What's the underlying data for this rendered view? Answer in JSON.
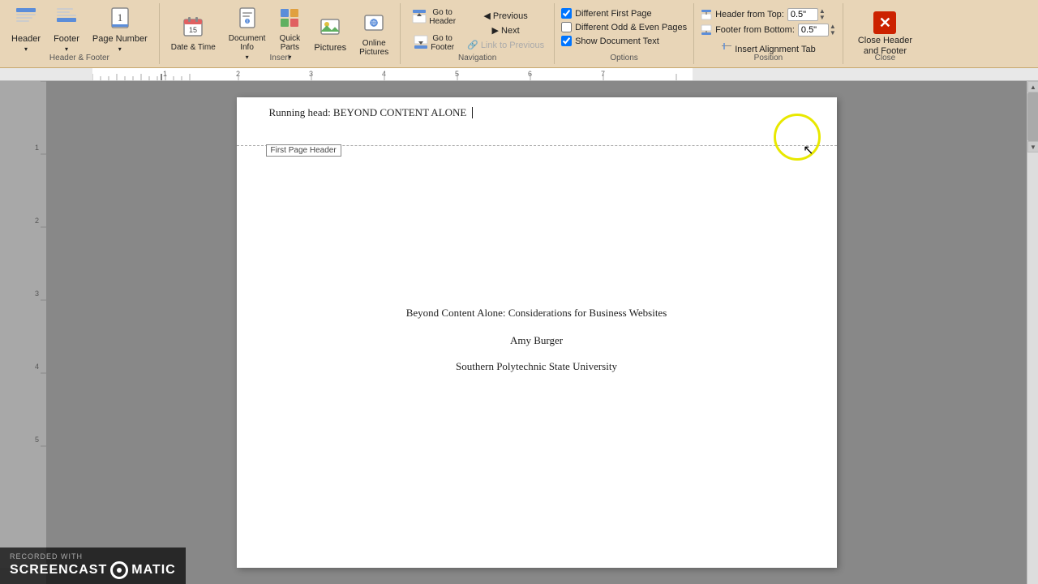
{
  "ribbon": {
    "groups": {
      "header_footer": {
        "label": "Header & Footer",
        "header_btn": {
          "label": "Header",
          "icon": "📄"
        },
        "footer_btn": {
          "label": "Footer",
          "icon": "📄"
        },
        "page_number_btn": {
          "label": "Page Number",
          "icon": "🔢"
        }
      },
      "insert": {
        "label": "Insert",
        "date_time": {
          "label": "Date & Time",
          "icon": "📅"
        },
        "document_info": {
          "label": "Document Info",
          "icon": "ℹ"
        },
        "quick_parts": {
          "label": "Quick Parts",
          "icon": "⚡"
        },
        "pictures": {
          "label": "Pictures",
          "icon": "🖼"
        },
        "online_pictures": {
          "label": "Online Pictures",
          "icon": "🌐"
        }
      },
      "navigation": {
        "label": "Navigation",
        "go_to_header": {
          "label": "Go to Header",
          "icon": "↑"
        },
        "go_to_footer": {
          "label": "Go to Footer",
          "icon": "↓"
        },
        "previous": {
          "label": "Previous"
        },
        "next": {
          "label": "Next"
        },
        "link_to_previous": {
          "label": "Link to Previous"
        }
      },
      "options": {
        "label": "Options",
        "different_first_page": {
          "label": "Different First Page",
          "checked": true
        },
        "different_odd_even": {
          "label": "Different Odd & Even Pages",
          "checked": false
        },
        "show_document_text": {
          "label": "Show Document Text",
          "checked": true
        }
      },
      "position": {
        "label": "Position",
        "header_from_top": {
          "label": "Header from Top:",
          "value": "0.5\""
        },
        "footer_from_bottom": {
          "label": "Footer from Bottom:",
          "value": "0.5\""
        },
        "insert_alignment_tab": {
          "label": "Insert Alignment Tab"
        }
      },
      "close": {
        "label": "Close",
        "close_header_footer": {
          "label": "Close Header\nand Footer"
        }
      }
    }
  },
  "document": {
    "header_text": "Running head: BEYOND CONTENT ALONE",
    "first_page_label": "First Page Header",
    "title": "Beyond Content Alone: Considerations for Business Websites",
    "author": "Amy Burger",
    "institution": "Southern Polytechnic State University"
  },
  "watermark": {
    "recorded_with": "RECORDED WITH",
    "brand": "SCREENCAST",
    "suffix": "MATIC"
  }
}
